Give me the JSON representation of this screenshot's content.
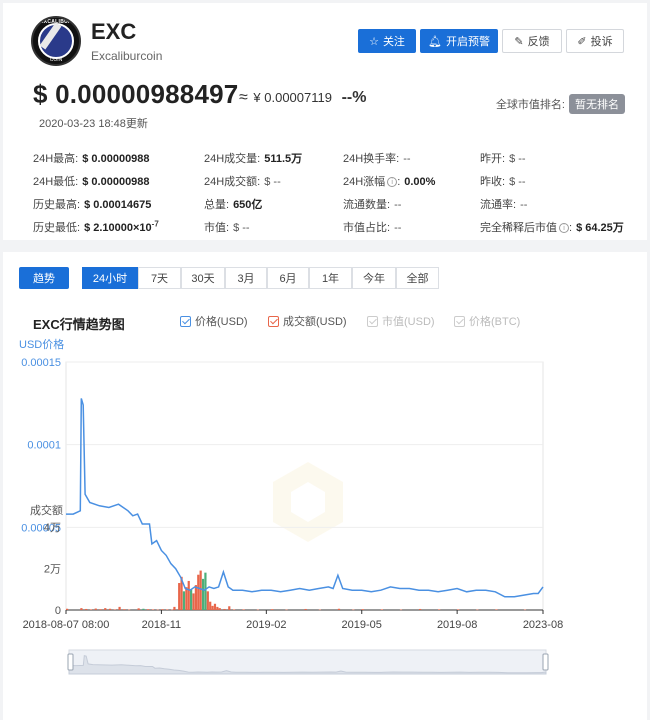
{
  "coin": {
    "symbol": "EXC",
    "name": "Excaliburcoin",
    "logo_text_top": "EXCALIBUR",
    "logo_text_bottom": "COIN"
  },
  "actions": {
    "follow": "关注",
    "alert": "开启预警",
    "feedback": "反馈",
    "complain": "投诉"
  },
  "price": {
    "usd": "$ 0.00000988497",
    "approx_sign": "≈",
    "cny": "¥ 0.00007119",
    "change": "--%",
    "updated": "2020-03-23 18:48更新"
  },
  "rank": {
    "label": "全球市值排名:",
    "badge": "暂无排名"
  },
  "stats": {
    "high24": {
      "label": "24H最高:",
      "value": "$ 0.00000988"
    },
    "low24": {
      "label": "24H最低:",
      "value": "$ 0.00000988"
    },
    "ath": {
      "label": "历史最高:",
      "value": "$ 0.00014675"
    },
    "atl": {
      "label": "历史最低:",
      "value": "$ 2.10000×10",
      "exp": "-7"
    },
    "vol24": {
      "label": "24H成交量:",
      "value": "511.5万"
    },
    "turnover24": {
      "label": "24H成交额:",
      "value": "$ --"
    },
    "supply": {
      "label": "总量:",
      "value": "650亿"
    },
    "mcap": {
      "label": "市值:",
      "value": "$ --"
    },
    "turnover_rate": {
      "label": "24H换手率:",
      "value": "--"
    },
    "change24": {
      "label": "24H涨幅",
      "value": "0.00%"
    },
    "circulating": {
      "label": "流通数量:",
      "value": "--"
    },
    "mcap_share": {
      "label": "市值占比:",
      "value": "--"
    },
    "open": {
      "label": "昨开:",
      "value": "$ --"
    },
    "close": {
      "label": "昨收:",
      "value": "$ --"
    },
    "circ_rate": {
      "label": "流通率:",
      "value": "--"
    },
    "fdv": {
      "label": "完全稀释后市值",
      "value": "$ 64.25万"
    }
  },
  "tabs": {
    "trend": "趋势",
    "ranges": [
      "24小时",
      "7天",
      "30天",
      "3月",
      "6月",
      "1年",
      "今年",
      "全部"
    ],
    "active_range": "24小时"
  },
  "chart": {
    "title": "EXC行情趋势图",
    "legend": [
      {
        "label": "价格(USD)",
        "color": "#4a90e2",
        "checked": true,
        "enabled": true
      },
      {
        "label": "成交额(USD)",
        "color": "#e8664a",
        "checked": true,
        "enabled": true
      },
      {
        "label": "市值(USD)",
        "color": "#c8c8c8",
        "checked": true,
        "enabled": false
      },
      {
        "label": "价格(BTC)",
        "color": "#c8c8c8",
        "checked": true,
        "enabled": false
      }
    ]
  },
  "chart_data": {
    "type": "line",
    "title": "EXC行情趋势图",
    "ylabel": "USD价格",
    "ylabel2": "成交额",
    "price_ticks": [
      "0.00015",
      "0.0001",
      "0.00005"
    ],
    "price_ylim": [
      0,
      0.00015
    ],
    "volume_ticks": [
      "4万",
      "2万",
      "0"
    ],
    "volume_ylim": [
      0,
      40000
    ],
    "x_ticks": [
      "2018-08-07 08:00",
      "2018-11",
      "2019-02",
      "2019-05",
      "2019-08",
      "2023-08"
    ],
    "series": [
      {
        "name": "价格(USD)",
        "color": "#4a90e2",
        "points": [
          [
            0,
            5.8e-05
          ],
          [
            0.015,
            5.8e-05
          ],
          [
            0.03,
            6e-05
          ],
          [
            0.032,
            0.000128
          ],
          [
            0.036,
            0.000124
          ],
          [
            0.04,
            7e-05
          ],
          [
            0.05,
            6.5e-05
          ],
          [
            0.07,
            6.3e-05
          ],
          [
            0.09,
            6.2e-05
          ],
          [
            0.11,
            6.4e-05
          ],
          [
            0.13,
            6e-05
          ],
          [
            0.14,
            5.7e-05
          ],
          [
            0.15,
            5.8e-05
          ],
          [
            0.16,
            5.2e-05
          ],
          [
            0.175,
            5.2e-05
          ],
          [
            0.18,
            4e-05
          ],
          [
            0.19,
            4.2e-05
          ],
          [
            0.2,
            3.6e-05
          ],
          [
            0.21,
            3.3e-05
          ],
          [
            0.22,
            2.8e-05
          ],
          [
            0.23,
            2.5e-05
          ],
          [
            0.24,
            2e-05
          ],
          [
            0.25,
            1.3e-05
          ],
          [
            0.26,
            1.2e-05
          ],
          [
            0.27,
            1.4e-05
          ],
          [
            0.28,
            1.3e-05
          ],
          [
            0.29,
            1.2e-05
          ],
          [
            0.3,
            1.4e-05
          ],
          [
            0.31,
            1.3e-05
          ],
          [
            0.32,
            1.4e-05
          ],
          [
            0.33,
            2.3e-05
          ],
          [
            0.34,
            1.4e-05
          ],
          [
            0.35,
            1.2e-05
          ],
          [
            0.37,
            1.2e-05
          ],
          [
            0.39,
            1.1e-05
          ],
          [
            0.41,
            1.2e-05
          ],
          [
            0.43,
            1.2e-05
          ],
          [
            0.45,
            1.1e-05
          ],
          [
            0.47,
            1.2e-05
          ],
          [
            0.49,
            1.3e-05
          ],
          [
            0.51,
            1.2e-05
          ],
          [
            0.53,
            1.3e-05
          ],
          [
            0.55,
            1.4e-05
          ],
          [
            0.56,
            1.3e-05
          ],
          [
            0.57,
            2.1e-05
          ],
          [
            0.58,
            1.3e-05
          ],
          [
            0.6,
            1.2e-05
          ],
          [
            0.62,
            1.2e-05
          ],
          [
            0.64,
            1.1e-05
          ],
          [
            0.66,
            1.2e-05
          ],
          [
            0.68,
            1.4e-05
          ],
          [
            0.7,
            1.3e-05
          ],
          [
            0.72,
            1.3e-05
          ],
          [
            0.74,
            1.2e-05
          ],
          [
            0.76,
            1.2e-05
          ],
          [
            0.78,
            1.1e-05
          ],
          [
            0.8,
            1.2e-05
          ],
          [
            0.82,
            1.3e-05
          ],
          [
            0.84,
            1.1e-05
          ],
          [
            0.86,
            1.2e-05
          ],
          [
            0.88,
            1.2e-05
          ],
          [
            0.9,
            1.1e-05
          ],
          [
            0.92,
            8e-06
          ],
          [
            0.94,
            8e-06
          ],
          [
            0.96,
            9e-06
          ],
          [
            0.98,
            1e-05
          ],
          [
            0.99,
            1e-05
          ],
          [
            1.0,
            1.4e-05
          ]
        ]
      },
      {
        "name": "成交额(USD)",
        "color": "#e8664a",
        "bars": [
          [
            0.0,
            600,
            "#e8664a"
          ],
          [
            0.03,
            900,
            "#e8664a"
          ],
          [
            0.04,
            500,
            "#e8664a"
          ],
          [
            0.05,
            300,
            "#e8664a"
          ],
          [
            0.06,
            700,
            "#e8664a"
          ],
          [
            0.07,
            400,
            "#e8664a"
          ],
          [
            0.08,
            900,
            "#e8664a"
          ],
          [
            0.09,
            600,
            "#e8664a"
          ],
          [
            0.1,
            300,
            "#e8664a"
          ],
          [
            0.11,
            1500,
            "#e8664a"
          ],
          [
            0.12,
            400,
            "#e8664a"
          ],
          [
            0.13,
            200,
            "#e8664a"
          ],
          [
            0.15,
            800,
            "#e8664a"
          ],
          [
            0.16,
            600,
            "#4cae7a"
          ],
          [
            0.17,
            400,
            "#e8664a"
          ],
          [
            0.18,
            300,
            "#e8664a"
          ],
          [
            0.19,
            200,
            "#e8664a"
          ],
          [
            0.2,
            400,
            "#e8664a"
          ],
          [
            0.21,
            300,
            "#e8664a"
          ],
          [
            0.22,
            200,
            "#e8664a"
          ],
          [
            0.225,
            1500,
            "#e8664a"
          ],
          [
            0.235,
            13000,
            "#e8664a"
          ],
          [
            0.24,
            16000,
            "#e8664a"
          ],
          [
            0.245,
            9000,
            "#4cae7a"
          ],
          [
            0.25,
            11000,
            "#e8664a"
          ],
          [
            0.255,
            14000,
            "#e8664a"
          ],
          [
            0.26,
            10000,
            "#4cae7a"
          ],
          [
            0.265,
            8000,
            "#e8664a"
          ],
          [
            0.27,
            12000,
            "#e8664a"
          ],
          [
            0.275,
            17000,
            "#e8664a"
          ],
          [
            0.28,
            19000,
            "#e8664a"
          ],
          [
            0.285,
            15000,
            "#4cae7a"
          ],
          [
            0.29,
            18000,
            "#4cae7a"
          ],
          [
            0.295,
            9000,
            "#e8664a"
          ],
          [
            0.3,
            4000,
            "#e8664a"
          ],
          [
            0.305,
            2000,
            "#e8664a"
          ],
          [
            0.31,
            3000,
            "#e8664a"
          ],
          [
            0.315,
            1500,
            "#e8664a"
          ],
          [
            0.32,
            900,
            "#e8664a"
          ],
          [
            0.33,
            500,
            "#e8664a"
          ],
          [
            0.34,
            1800,
            "#e8664a"
          ],
          [
            0.35,
            300,
            "#e8664a"
          ],
          [
            0.37,
            300,
            "#e8664a"
          ],
          [
            0.4,
            200,
            "#e8664a"
          ],
          [
            0.43,
            400,
            "#e8664a"
          ],
          [
            0.46,
            200,
            "#e8664a"
          ],
          [
            0.5,
            500,
            "#e8664a"
          ],
          [
            0.53,
            200,
            "#e8664a"
          ],
          [
            0.57,
            600,
            "#e8664a"
          ],
          [
            0.6,
            200,
            "#e8664a"
          ],
          [
            0.62,
            400,
            "#e8664a"
          ],
          [
            0.66,
            300,
            "#e8664a"
          ],
          [
            0.7,
            200,
            "#e8664a"
          ],
          [
            0.74,
            500,
            "#e8664a"
          ],
          [
            0.78,
            300,
            "#e8664a"
          ],
          [
            0.82,
            300,
            "#e8664a"
          ],
          [
            0.86,
            200,
            "#e8664a"
          ],
          [
            0.9,
            300,
            "#e8664a"
          ],
          [
            0.96,
            200,
            "#e8664a"
          ]
        ]
      }
    ],
    "grid": true
  }
}
